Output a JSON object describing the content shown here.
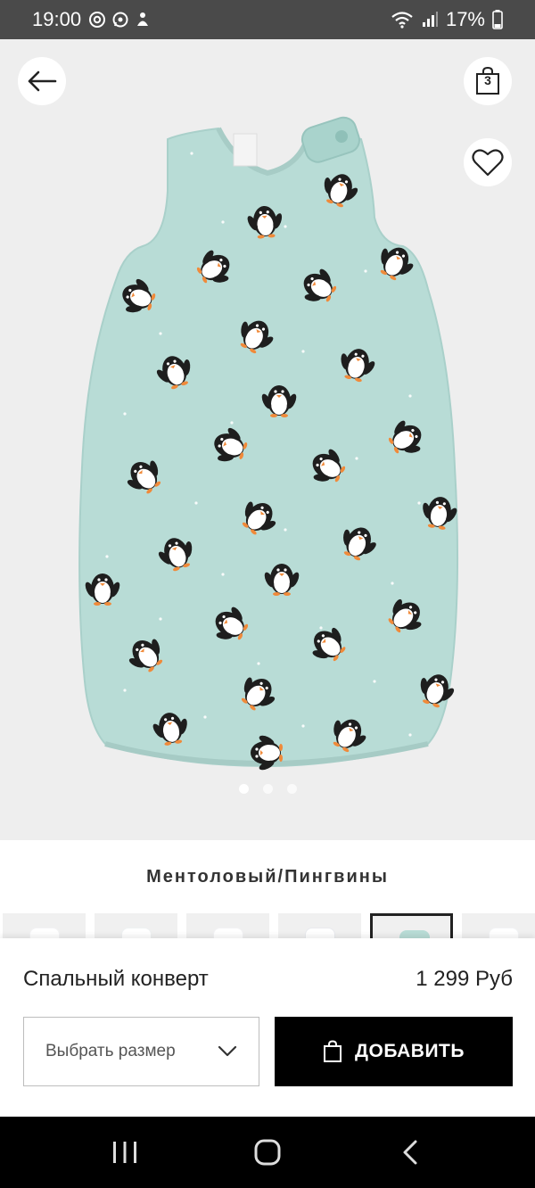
{
  "status_bar": {
    "time": "19:00",
    "left_icons": [
      "at-sign-icon",
      "whatsapp-icon",
      "notification-icon"
    ],
    "right_icons": [
      "wifi-icon",
      "signal-icon"
    ],
    "battery_percent": "17%"
  },
  "gallery": {
    "bag_count": "3",
    "total_images": 3,
    "active_index": 0,
    "background": "#eeeeee",
    "product_color": "#b8dcd6"
  },
  "product": {
    "color_name": "Ментоловый/Пингвины",
    "name": "Спальный конверт",
    "price": "1 299 Руб",
    "variant_colors": [
      "#f3f3f5",
      "#eef1f2",
      "#f2f2f4",
      "#e9eaee",
      "#b8dcd6",
      "#f2f3f5"
    ],
    "active_variant": 4
  },
  "actions": {
    "size_placeholder": "Выбрать размер",
    "add_label": "ДОБАВИТЬ"
  },
  "nav": {
    "buttons": [
      "recents-icon",
      "home-icon",
      "back-icon"
    ]
  }
}
